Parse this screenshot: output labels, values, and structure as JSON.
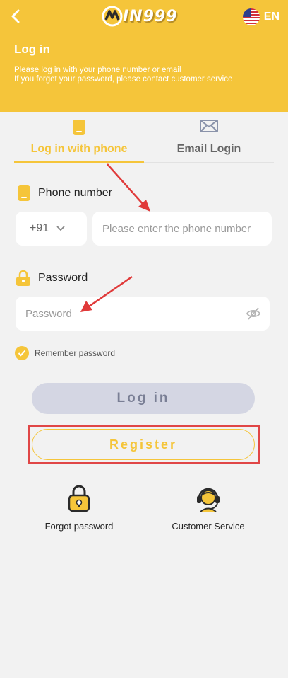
{
  "header": {
    "logo_text": "IN999",
    "language": "EN",
    "title": "Log in",
    "subtitle_line1": "Please log in with your phone number or email",
    "subtitle_line2": "If you forget your password, please contact customer service"
  },
  "tabs": [
    {
      "label": "Log in with phone",
      "active": true
    },
    {
      "label": "Email Login",
      "active": false
    }
  ],
  "phone": {
    "label": "Phone number",
    "country_code": "+91",
    "placeholder": "Please enter the phone number"
  },
  "password": {
    "label": "Password",
    "placeholder": "Password"
  },
  "remember": {
    "label": "Remember password",
    "checked": true
  },
  "buttons": {
    "login": "Log in",
    "register": "Register"
  },
  "links": {
    "forgot": "Forgot password",
    "service": "Customer Service"
  },
  "colors": {
    "accent": "#f5c53a",
    "highlight": "#e04646",
    "background": "#f2f2f2"
  }
}
